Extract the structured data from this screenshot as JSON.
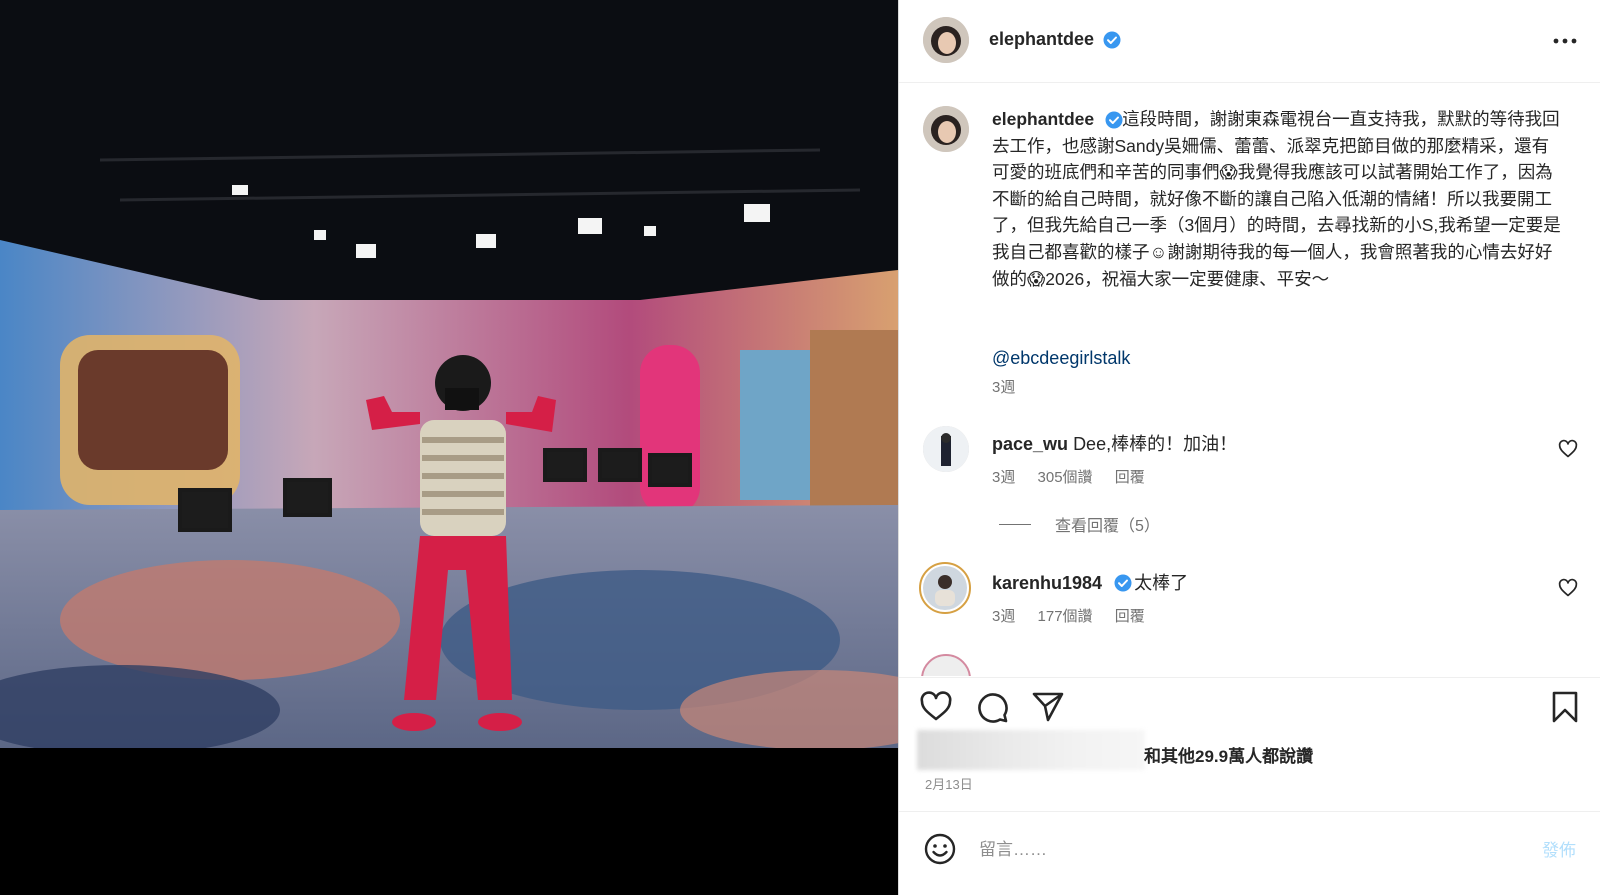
{
  "post": {
    "author": "elephantdee",
    "caption": {
      "username": "elephantdee",
      "text": "這段時間，謝謝東森電視台一直支持我，默默的等待我回去工作，也感謝Sandy吳姍儒、蕾蕾、派翠克把節目做的那麼精采，還有可愛的班底們和辛苦的同事們😱我覺得我應該可以試著開始工作了，因為不斷的給自己時間，就好像不斷的讓自己陷入低潮的情緒！所以我要開工了，但我先給自己一季（3個月）的時間，去尋找新的小S,我希望一定要是我自己都喜歡的樣子☺謝謝期待我的每一個人，我會照著我的心情去好好做的😱2026，祝福大家一定要健康、平安～",
      "mention": "@ebcdeegirlstalk",
      "time": "3週"
    },
    "comments": [
      {
        "username": "pace_wu",
        "text": "Dee,棒棒的！加油！",
        "time": "3週",
        "likes": "305個讚",
        "reply": "回覆",
        "view_replies": "查看回覆（5）"
      },
      {
        "username": "karenhu1984",
        "text": "太棒了",
        "time": "3週",
        "likes": "177個讚",
        "reply": "回覆"
      }
    ],
    "likes_text": "和其他29.9萬人都說讚",
    "date": "2月13日"
  },
  "composer": {
    "placeholder": "留言……",
    "post_label": "發佈"
  },
  "icons": {
    "more": "more-horizontal-icon",
    "like": "heart-icon",
    "comment": "comment-bubble-icon",
    "share": "paper-plane-icon",
    "save": "bookmark-icon",
    "emoji": "smiley-icon",
    "verified": "verified-badge-icon"
  },
  "colors": {
    "link": "#00376b",
    "verified": "#3897f0",
    "muted": "#737373",
    "post_disabled": "#b2dffc"
  }
}
